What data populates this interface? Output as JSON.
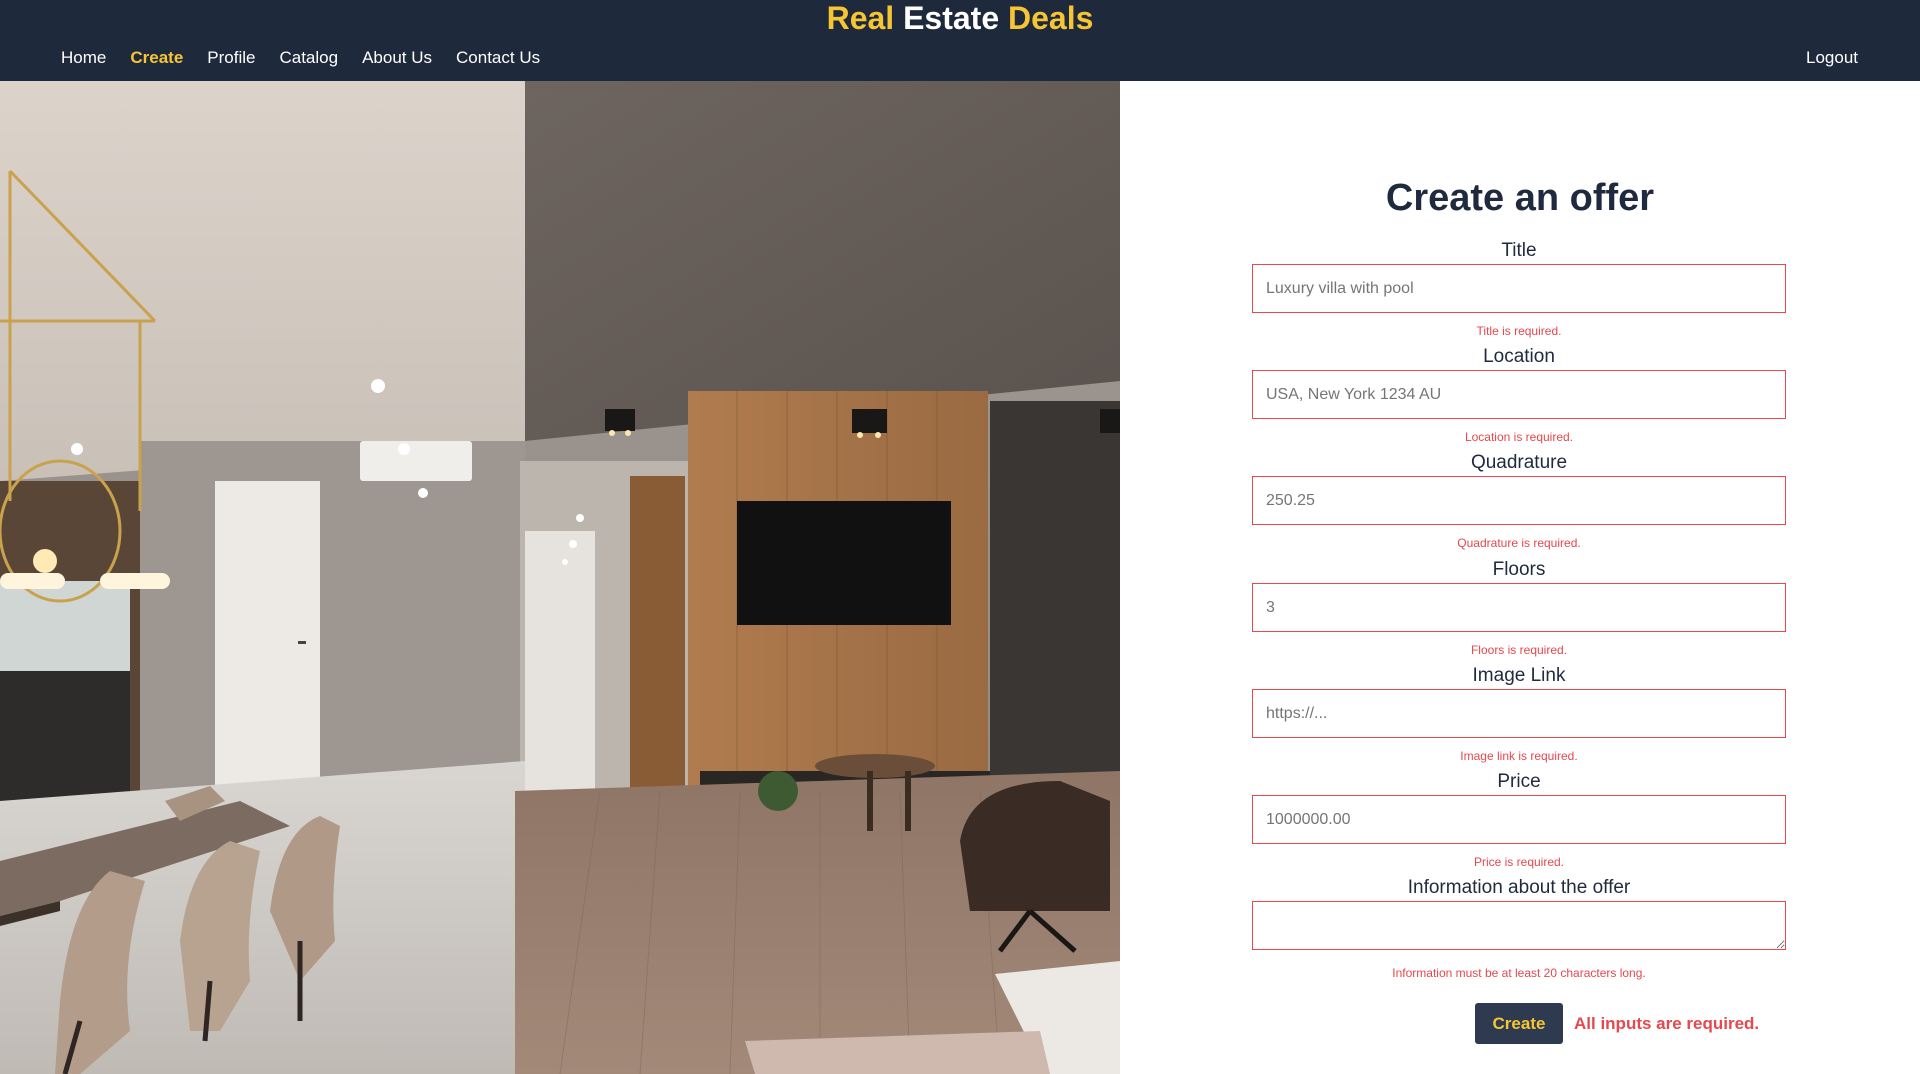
{
  "brand": {
    "part1": "Real",
    "part2": "Estate",
    "part3": "Deals"
  },
  "nav": {
    "items": [
      {
        "label": "Home"
      },
      {
        "label": "Create"
      },
      {
        "label": "Profile"
      },
      {
        "label": "Catalog"
      },
      {
        "label": "About Us"
      },
      {
        "label": "Contact Us"
      }
    ],
    "active": "Create",
    "logout": "Logout"
  },
  "form": {
    "title": "Create an offer",
    "fields": [
      {
        "label": "Title",
        "placeholder": "Luxury villa with pool",
        "error": "Title is required."
      },
      {
        "label": "Location",
        "placeholder": "USA, New York 1234 AU",
        "error": "Location is required."
      },
      {
        "label": "Quadrature",
        "placeholder": "250.25",
        "error": "Quadrature is required."
      },
      {
        "label": "Floors",
        "placeholder": "3",
        "error": "Floors is required."
      },
      {
        "label": "Image Link",
        "placeholder": "https://...",
        "error": "Image link is required."
      },
      {
        "label": "Price",
        "placeholder": "1000000.00",
        "error": "Price is required."
      },
      {
        "label": "Information about the offer",
        "placeholder": "",
        "error": "Information must be at least 20 characters long."
      }
    ],
    "submit_label": "Create",
    "form_error": "All inputs are required."
  },
  "colors": {
    "header_bg": "#1e293b",
    "accent": "#f5c533",
    "error": "#e5484d",
    "button_bg": "#2d3a50"
  }
}
